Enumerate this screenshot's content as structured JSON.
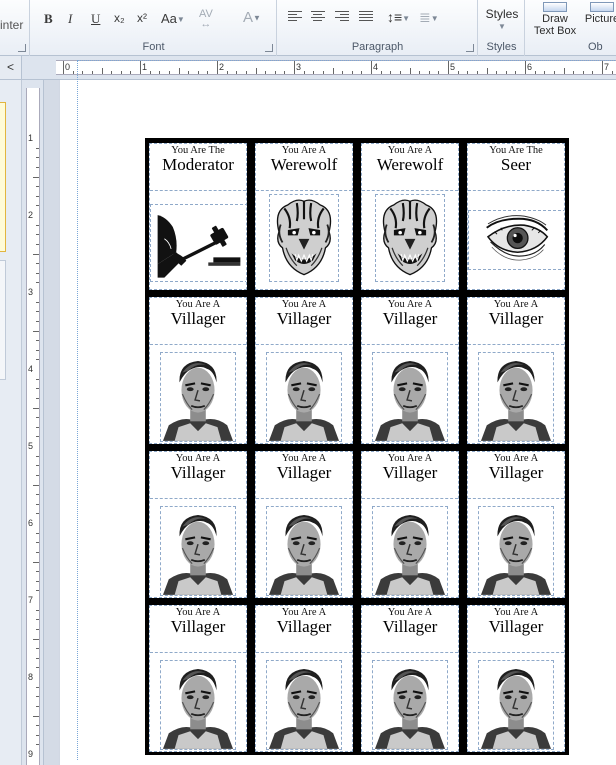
{
  "ribbon": {
    "clipboard_fragment": "inter",
    "font_group_label": "Font",
    "paragraph_group_label": "Paragraph",
    "styles_group_label": "Styles",
    "styles_button_label": "Styles",
    "draw_text_box_label_1": "Draw",
    "draw_text_box_label_2": "Text Box",
    "picture_label": "Picture",
    "objects_fragment": "Ob",
    "bold": "B",
    "italic": "I",
    "underline": "U",
    "subscript": "x₂",
    "superscript": "x²",
    "change_case": "Aa",
    "char_spacing": "AV",
    "font_color": "A"
  },
  "nav": {
    "collapse_arrow": "<"
  },
  "ruler": {
    "h_labels": [
      "0",
      "1",
      "2",
      "3",
      "4",
      "5",
      "6",
      "7"
    ],
    "v_labels": [
      "1",
      "2",
      "3",
      "4",
      "5",
      "6",
      "7",
      "8",
      "9"
    ]
  },
  "cards": [
    {
      "pre": "You Are The",
      "role": "Moderator",
      "image": "gavel-image"
    },
    {
      "pre": "You Are A",
      "role": "Werewolf",
      "image": "werewolf-image"
    },
    {
      "pre": "You Are A",
      "role": "Werewolf",
      "image": "werewolf-image"
    },
    {
      "pre": "You Are The",
      "role": "Seer",
      "image": "eye-image"
    },
    {
      "pre": "You Are A",
      "role": "Villager",
      "image": "villager-image"
    },
    {
      "pre": "You Are A",
      "role": "Villager",
      "image": "villager-image"
    },
    {
      "pre": "You Are A",
      "role": "Villager",
      "image": "villager-image"
    },
    {
      "pre": "You Are A",
      "role": "Villager",
      "image": "villager-image"
    },
    {
      "pre": "You Are A",
      "role": "Villager",
      "image": "villager-image"
    },
    {
      "pre": "You Are A",
      "role": "Villager",
      "image": "villager-image"
    },
    {
      "pre": "You Are A",
      "role": "Villager",
      "image": "villager-image"
    },
    {
      "pre": "You Are A",
      "role": "Villager",
      "image": "villager-image"
    },
    {
      "pre": "You Are A",
      "role": "Villager",
      "image": "villager-image"
    },
    {
      "pre": "You Are A",
      "role": "Villager",
      "image": "villager-image"
    },
    {
      "pre": "You Are A",
      "role": "Villager",
      "image": "villager-image"
    },
    {
      "pre": "You Are A",
      "role": "Villager",
      "image": "villager-image"
    }
  ]
}
